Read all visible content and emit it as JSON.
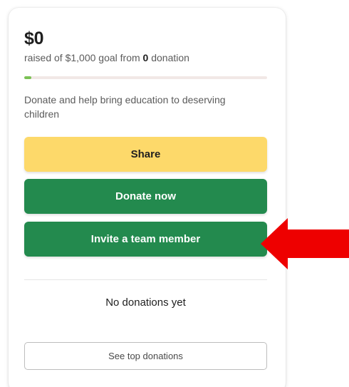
{
  "fundraiser": {
    "amount_raised": "$0",
    "raised_prefix": "raised of $1,000 goal from ",
    "donation_count": "0",
    "raised_suffix": " donation",
    "progress_percent": 0,
    "description": "Donate and help bring education to deserving children"
  },
  "actions": {
    "share_label": "Share",
    "donate_label": "Donate now",
    "invite_label": "Invite a team member"
  },
  "donations": {
    "empty_text": "No donations yet",
    "see_top_label": "See top donations"
  },
  "colors": {
    "share": "#fdd96a",
    "primary": "#238a4e",
    "progress_fill": "#7bc155",
    "arrow": "#ee0000"
  },
  "annotation": {
    "icon": "red-arrow-icon"
  }
}
